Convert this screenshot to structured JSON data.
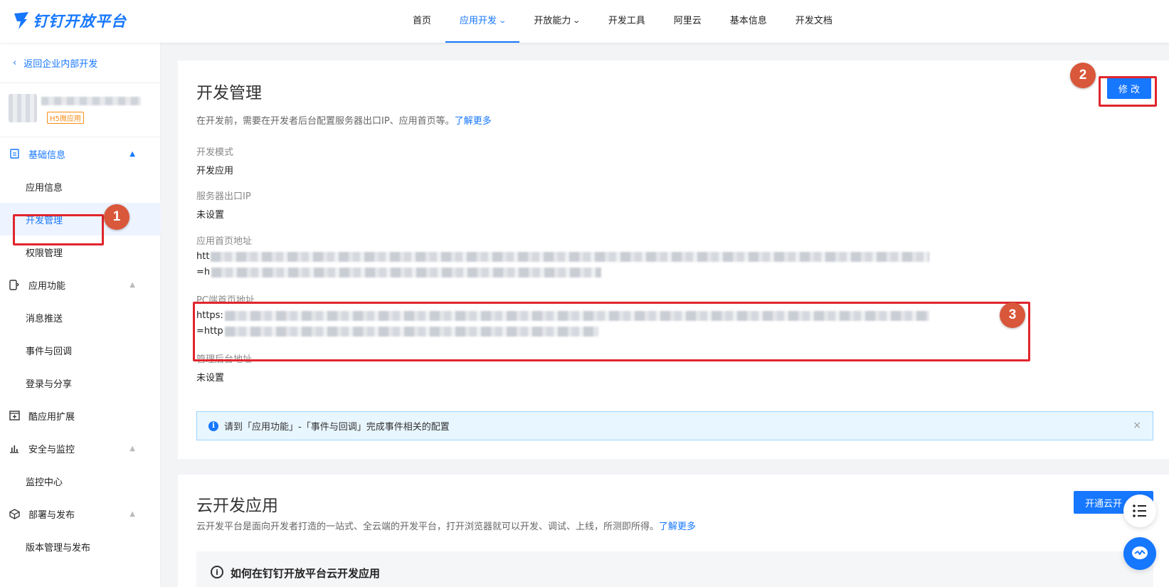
{
  "header": {
    "logo_text": "钉钉开放平台",
    "nav": [
      {
        "label": "首页",
        "active": false,
        "dropdown": false
      },
      {
        "label": "应用开发",
        "active": true,
        "dropdown": true
      },
      {
        "label": "开放能力",
        "active": false,
        "dropdown": true
      },
      {
        "label": "开发工具",
        "active": false,
        "dropdown": false
      },
      {
        "label": "阿里云",
        "active": false,
        "dropdown": false
      },
      {
        "label": "基本信息",
        "active": false,
        "dropdown": false
      },
      {
        "label": "开发文档",
        "active": false,
        "dropdown": false
      }
    ]
  },
  "sidebar": {
    "back_label": "返回企业内部开发",
    "app_tag": "H5微应用",
    "items": [
      {
        "label": "基础信息",
        "type": "group",
        "icon": "document-icon",
        "expanded": true
      },
      {
        "label": "应用信息",
        "type": "sub"
      },
      {
        "label": "开发管理",
        "type": "sub",
        "selected": true
      },
      {
        "label": "权限管理",
        "type": "sub"
      },
      {
        "label": "应用功能",
        "type": "group",
        "icon": "app-function-icon",
        "expanded": true
      },
      {
        "label": "消息推送",
        "type": "sub"
      },
      {
        "label": "事件与回调",
        "type": "sub"
      },
      {
        "label": "登录与分享",
        "type": "sub"
      },
      {
        "label": "酷应用扩展",
        "type": "group",
        "icon": "add-box-icon"
      },
      {
        "label": "安全与监控",
        "type": "group",
        "icon": "bar-chart-icon",
        "expanded": true
      },
      {
        "label": "监控中心",
        "type": "sub"
      },
      {
        "label": "部署与发布",
        "type": "group",
        "icon": "cube-icon",
        "expanded": true
      },
      {
        "label": "版本管理与发布",
        "type": "sub"
      }
    ]
  },
  "dev_manage": {
    "title": "开发管理",
    "desc": "在开发前，需要在开发者后台配置服务器出口IP、应用首页等。",
    "learn_more": "了解更多",
    "edit_button": "修 改",
    "fields": [
      {
        "label": "开发模式",
        "value": "开发应用"
      },
      {
        "label": "服务器出口IP",
        "value": "未设置"
      },
      {
        "label": "应用首页地址",
        "value_prefix_1": "htt",
        "value_prefix_2": "=h"
      },
      {
        "label": "PC端首页地址",
        "value_prefix_1": "https:",
        "value_prefix_2": "=http"
      },
      {
        "label": "管理后台地址",
        "value": "未设置"
      }
    ],
    "alert_text": "请到「应用功能」-「事件与回调」完成事件相关的配置",
    "alert_close": "×"
  },
  "cloud_dev": {
    "title": "云开发应用",
    "desc": "云开发平台是面向开发者打造的一站式、全云端的开发平台，打开浏览器就可以开发、调试、上线，所测即所得。",
    "learn_more": "了解更多",
    "open_button": "开通云开",
    "inner_title": "如何在钉钉开放平台云开发应用"
  },
  "annotations": [
    "1",
    "2",
    "3"
  ],
  "colors": {
    "accent": "#1677ff",
    "highlight": "#e0252b",
    "badge": "#d9573a"
  }
}
